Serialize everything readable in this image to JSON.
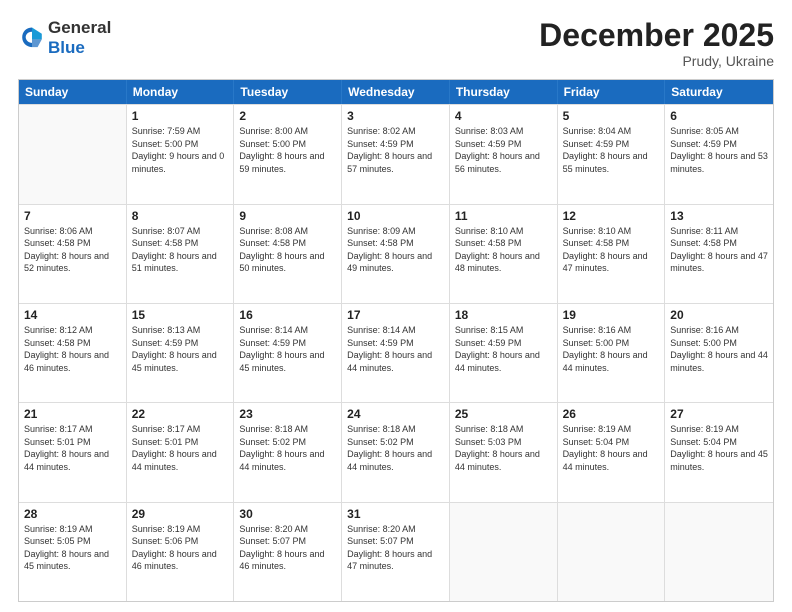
{
  "header": {
    "logo": {
      "line1": "General",
      "line2": "Blue"
    },
    "month": "December 2025",
    "location": "Prudy, Ukraine"
  },
  "weekdays": [
    "Sunday",
    "Monday",
    "Tuesday",
    "Wednesday",
    "Thursday",
    "Friday",
    "Saturday"
  ],
  "weeks": [
    [
      {
        "day": "",
        "sunrise": "",
        "sunset": "",
        "daylight": ""
      },
      {
        "day": "1",
        "sunrise": "Sunrise: 7:59 AM",
        "sunset": "Sunset: 5:00 PM",
        "daylight": "Daylight: 9 hours and 0 minutes."
      },
      {
        "day": "2",
        "sunrise": "Sunrise: 8:00 AM",
        "sunset": "Sunset: 5:00 PM",
        "daylight": "Daylight: 8 hours and 59 minutes."
      },
      {
        "day": "3",
        "sunrise": "Sunrise: 8:02 AM",
        "sunset": "Sunset: 4:59 PM",
        "daylight": "Daylight: 8 hours and 57 minutes."
      },
      {
        "day": "4",
        "sunrise": "Sunrise: 8:03 AM",
        "sunset": "Sunset: 4:59 PM",
        "daylight": "Daylight: 8 hours and 56 minutes."
      },
      {
        "day": "5",
        "sunrise": "Sunrise: 8:04 AM",
        "sunset": "Sunset: 4:59 PM",
        "daylight": "Daylight: 8 hours and 55 minutes."
      },
      {
        "day": "6",
        "sunrise": "Sunrise: 8:05 AM",
        "sunset": "Sunset: 4:59 PM",
        "daylight": "Daylight: 8 hours and 53 minutes."
      }
    ],
    [
      {
        "day": "7",
        "sunrise": "Sunrise: 8:06 AM",
        "sunset": "Sunset: 4:58 PM",
        "daylight": "Daylight: 8 hours and 52 minutes."
      },
      {
        "day": "8",
        "sunrise": "Sunrise: 8:07 AM",
        "sunset": "Sunset: 4:58 PM",
        "daylight": "Daylight: 8 hours and 51 minutes."
      },
      {
        "day": "9",
        "sunrise": "Sunrise: 8:08 AM",
        "sunset": "Sunset: 4:58 PM",
        "daylight": "Daylight: 8 hours and 50 minutes."
      },
      {
        "day": "10",
        "sunrise": "Sunrise: 8:09 AM",
        "sunset": "Sunset: 4:58 PM",
        "daylight": "Daylight: 8 hours and 49 minutes."
      },
      {
        "day": "11",
        "sunrise": "Sunrise: 8:10 AM",
        "sunset": "Sunset: 4:58 PM",
        "daylight": "Daylight: 8 hours and 48 minutes."
      },
      {
        "day": "12",
        "sunrise": "Sunrise: 8:10 AM",
        "sunset": "Sunset: 4:58 PM",
        "daylight": "Daylight: 8 hours and 47 minutes."
      },
      {
        "day": "13",
        "sunrise": "Sunrise: 8:11 AM",
        "sunset": "Sunset: 4:58 PM",
        "daylight": "Daylight: 8 hours and 47 minutes."
      }
    ],
    [
      {
        "day": "14",
        "sunrise": "Sunrise: 8:12 AM",
        "sunset": "Sunset: 4:58 PM",
        "daylight": "Daylight: 8 hours and 46 minutes."
      },
      {
        "day": "15",
        "sunrise": "Sunrise: 8:13 AM",
        "sunset": "Sunset: 4:59 PM",
        "daylight": "Daylight: 8 hours and 45 minutes."
      },
      {
        "day": "16",
        "sunrise": "Sunrise: 8:14 AM",
        "sunset": "Sunset: 4:59 PM",
        "daylight": "Daylight: 8 hours and 45 minutes."
      },
      {
        "day": "17",
        "sunrise": "Sunrise: 8:14 AM",
        "sunset": "Sunset: 4:59 PM",
        "daylight": "Daylight: 8 hours and 44 minutes."
      },
      {
        "day": "18",
        "sunrise": "Sunrise: 8:15 AM",
        "sunset": "Sunset: 4:59 PM",
        "daylight": "Daylight: 8 hours and 44 minutes."
      },
      {
        "day": "19",
        "sunrise": "Sunrise: 8:16 AM",
        "sunset": "Sunset: 5:00 PM",
        "daylight": "Daylight: 8 hours and 44 minutes."
      },
      {
        "day": "20",
        "sunrise": "Sunrise: 8:16 AM",
        "sunset": "Sunset: 5:00 PM",
        "daylight": "Daylight: 8 hours and 44 minutes."
      }
    ],
    [
      {
        "day": "21",
        "sunrise": "Sunrise: 8:17 AM",
        "sunset": "Sunset: 5:01 PM",
        "daylight": "Daylight: 8 hours and 44 minutes."
      },
      {
        "day": "22",
        "sunrise": "Sunrise: 8:17 AM",
        "sunset": "Sunset: 5:01 PM",
        "daylight": "Daylight: 8 hours and 44 minutes."
      },
      {
        "day": "23",
        "sunrise": "Sunrise: 8:18 AM",
        "sunset": "Sunset: 5:02 PM",
        "daylight": "Daylight: 8 hours and 44 minutes."
      },
      {
        "day": "24",
        "sunrise": "Sunrise: 8:18 AM",
        "sunset": "Sunset: 5:02 PM",
        "daylight": "Daylight: 8 hours and 44 minutes."
      },
      {
        "day": "25",
        "sunrise": "Sunrise: 8:18 AM",
        "sunset": "Sunset: 5:03 PM",
        "daylight": "Daylight: 8 hours and 44 minutes."
      },
      {
        "day": "26",
        "sunrise": "Sunrise: 8:19 AM",
        "sunset": "Sunset: 5:04 PM",
        "daylight": "Daylight: 8 hours and 44 minutes."
      },
      {
        "day": "27",
        "sunrise": "Sunrise: 8:19 AM",
        "sunset": "Sunset: 5:04 PM",
        "daylight": "Daylight: 8 hours and 45 minutes."
      }
    ],
    [
      {
        "day": "28",
        "sunrise": "Sunrise: 8:19 AM",
        "sunset": "Sunset: 5:05 PM",
        "daylight": "Daylight: 8 hours and 45 minutes."
      },
      {
        "day": "29",
        "sunrise": "Sunrise: 8:19 AM",
        "sunset": "Sunset: 5:06 PM",
        "daylight": "Daylight: 8 hours and 46 minutes."
      },
      {
        "day": "30",
        "sunrise": "Sunrise: 8:20 AM",
        "sunset": "Sunset: 5:07 PM",
        "daylight": "Daylight: 8 hours and 46 minutes."
      },
      {
        "day": "31",
        "sunrise": "Sunrise: 8:20 AM",
        "sunset": "Sunset: 5:07 PM",
        "daylight": "Daylight: 8 hours and 47 minutes."
      },
      {
        "day": "",
        "sunrise": "",
        "sunset": "",
        "daylight": ""
      },
      {
        "day": "",
        "sunrise": "",
        "sunset": "",
        "daylight": ""
      },
      {
        "day": "",
        "sunrise": "",
        "sunset": "",
        "daylight": ""
      }
    ]
  ]
}
